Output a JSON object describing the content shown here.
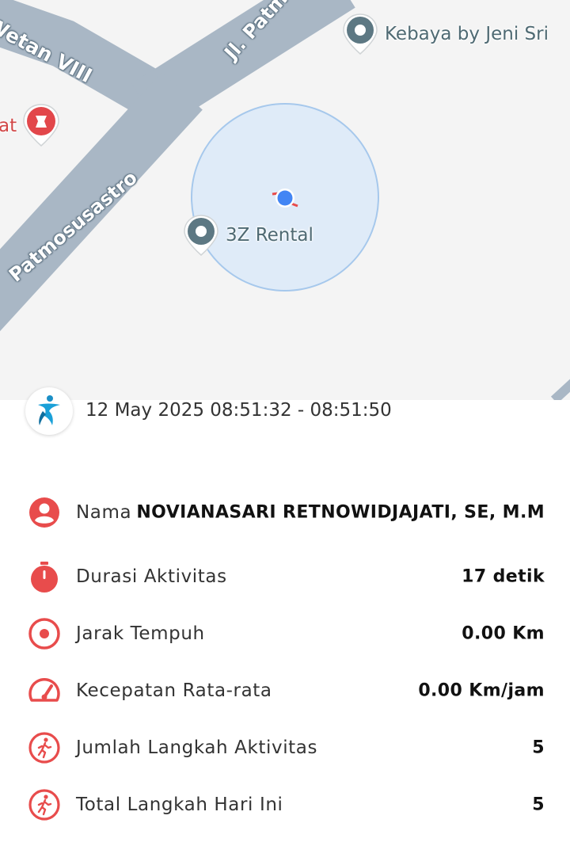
{
  "map": {
    "streets": {
      "wetan": "Wetan VIII",
      "jl_patm": "Jl. Patm",
      "patmosusastro": "Patmosusastro"
    },
    "places": [
      {
        "name": "Kebaya by Jeni Sri",
        "icon": "place-pin-icon"
      },
      {
        "name": "3Z Rental",
        "icon": "place-pin-icon"
      },
      {
        "name": "at",
        "icon": "pharmacy-pin-icon"
      }
    ]
  },
  "activity": {
    "time_range": "12 May 2025 08:51:32 - 08:51:50",
    "rows": [
      {
        "icon": "person-icon",
        "label": "Nama",
        "value": "NOVIANASARI RETNOWIDJAJATI, SE, M.M"
      },
      {
        "icon": "stopwatch-icon",
        "label": "Durasi Aktivitas",
        "value": "17 detik"
      },
      {
        "icon": "target-icon",
        "label": "Jarak Tempuh",
        "value": "0.00 Km"
      },
      {
        "icon": "speedometer-icon",
        "label": "Kecepatan Rata-rata",
        "value": "0.00 Km/jam"
      },
      {
        "icon": "walking-icon",
        "label": "Jumlah Langkah Aktivitas",
        "value": "5"
      },
      {
        "icon": "walking-icon",
        "label": "Total Langkah Hari Ini",
        "value": "5"
      }
    ]
  },
  "colors": {
    "accent": "#e84c4c",
    "road": "#a9b7c5",
    "location_dot": "#4285f4",
    "accuracy_fill": "#dbe9f8",
    "accuracy_stroke": "#a6c8ec"
  }
}
